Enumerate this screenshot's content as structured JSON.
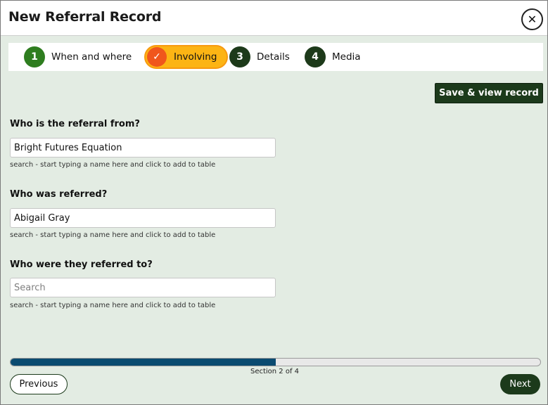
{
  "header": {
    "title": "New Referral Record",
    "close_icon": "close-icon",
    "close_glyph": "✕"
  },
  "stepper": {
    "steps": [
      {
        "number": "1",
        "label": "When and where",
        "state": "complete",
        "color": "#2e7d1f"
      },
      {
        "number": "✓",
        "label": "Involving",
        "state": "current",
        "color": "#f0561c",
        "highlight": "#fcb414"
      },
      {
        "number": "3",
        "label": "Details",
        "state": "upcoming",
        "color": "#1d3a1a"
      },
      {
        "number": "4",
        "label": "Media",
        "state": "upcoming",
        "color": "#1d3a1a"
      }
    ]
  },
  "toolbar": {
    "save_label": "Save & view record"
  },
  "form": {
    "fields": [
      {
        "label": "Who is the referral from?",
        "value": "Bright Futures Equation",
        "placeholder": "Search",
        "help": "search - start typing a name here and click to add to table"
      },
      {
        "label": "Who was referred?",
        "value": "Abigail Gray",
        "placeholder": "Search",
        "help": "search - start typing a name here and click to add to table"
      },
      {
        "label": "Who were they referred to?",
        "value": "",
        "placeholder": "Search",
        "help": "search - start typing a name here and click to add to table"
      }
    ]
  },
  "progress": {
    "fraction": 0.5,
    "text": "Section 2 of 4"
  },
  "footer": {
    "previous_label": "Previous",
    "next_label": "Next"
  },
  "colors": {
    "accent_dark": "#1c3a1b",
    "background": "#e3ece3",
    "progress_fill": "#0a4b70"
  }
}
